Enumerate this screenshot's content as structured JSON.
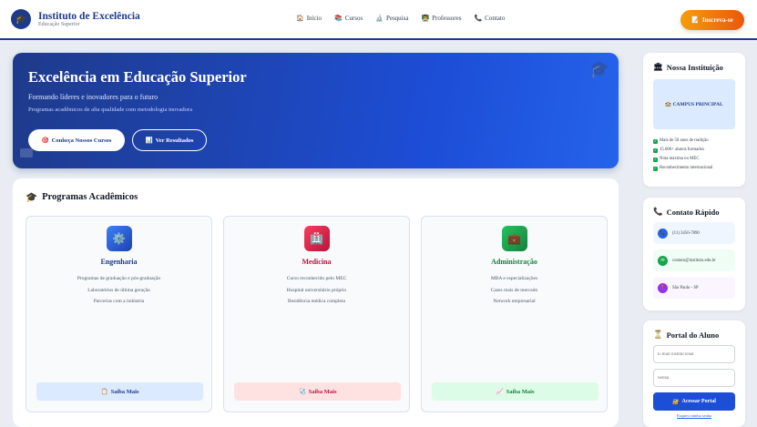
{
  "header": {
    "logo_icon": "graduation-cap-icon",
    "brand_title": "Instituto de Excelência",
    "brand_sub": "Educação Superior",
    "nav": [
      {
        "icon": "🏠",
        "label": "Início"
      },
      {
        "icon": "📚",
        "label": "Cursos"
      },
      {
        "icon": "🔬",
        "label": "Pesquisa"
      },
      {
        "icon": "👨‍🏫",
        "label": "Professores"
      },
      {
        "icon": "📞",
        "label": "Contato"
      }
    ],
    "cta_icon": "📝",
    "cta_label": "Inscreva-se"
  },
  "hero": {
    "title": "Excelência em Educação Superior",
    "subtitle": "Formando líderes e inovadores para o futuro",
    "description": "Programas acadêmicos de alta qualidade com metodologia inovadora",
    "btn_primary_icon": "🎯",
    "btn_primary": "Conheça Nossos Cursos",
    "btn_secondary_icon": "📊",
    "btn_secondary": "Ver Resultados",
    "deco_icon": "🎓"
  },
  "programs": {
    "icon": "🎓",
    "title": "Programas Acadêmicos",
    "cards": [
      {
        "icon": "⚙️",
        "title": "Engenharia",
        "lines": [
          "Programas de graduação e pós-graduação",
          "Laboratórios de última geração",
          "Parcerias com a indústria"
        ],
        "btn_icon": "📋",
        "btn": "Saiba Mais",
        "color": "#1e3a8a"
      },
      {
        "icon": "🏥",
        "title": "Medicina",
        "lines": [
          "Curso reconhecido pelo MEC",
          "Hospital universitário próprio",
          "Residência médica completa"
        ],
        "btn_icon": "🩺",
        "btn": "Saiba Mais",
        "color": "#be123c"
      },
      {
        "icon": "💼",
        "title": "Administração",
        "lines": [
          "MBA e especializações",
          "Cases reais de mercado",
          "Network empresarial"
        ],
        "btn_icon": "📈",
        "btn": "Saiba Mais",
        "color": "#15803d"
      }
    ]
  },
  "institution": {
    "icon": "🏛",
    "title": "Nossa Instituição",
    "campus_icon": "🏫",
    "campus": "CAMPUS PRINCIPAL",
    "facts": [
      "Mais de 50 anos de tradição",
      "15.000+ alunos formados",
      "Nota máxima no MEC",
      "Reconhecimento internacional"
    ]
  },
  "contact": {
    "icon": "📞",
    "title": "Contato Rápido",
    "items": [
      {
        "icon": "📞",
        "text": "(11) 3456-7890",
        "bg": "#eff6ff",
        "dot": "#2563eb"
      },
      {
        "icon": "✉",
        "text": "contato@instituto.edu.br",
        "bg": "#f0fdf4",
        "dot": "#16a34a"
      },
      {
        "icon": "📍",
        "text": "São Paulo - SP",
        "bg": "#faf5ff",
        "dot": "#9333ea"
      }
    ]
  },
  "portal": {
    "icon": "⏳",
    "title": "Portal do Aluno",
    "email_placeholder": "E-mail institucional",
    "password_placeholder": "Senha",
    "btn_icon": "🔐",
    "btn": "Acessar Portal",
    "forgot": "Esqueci minha senha"
  }
}
